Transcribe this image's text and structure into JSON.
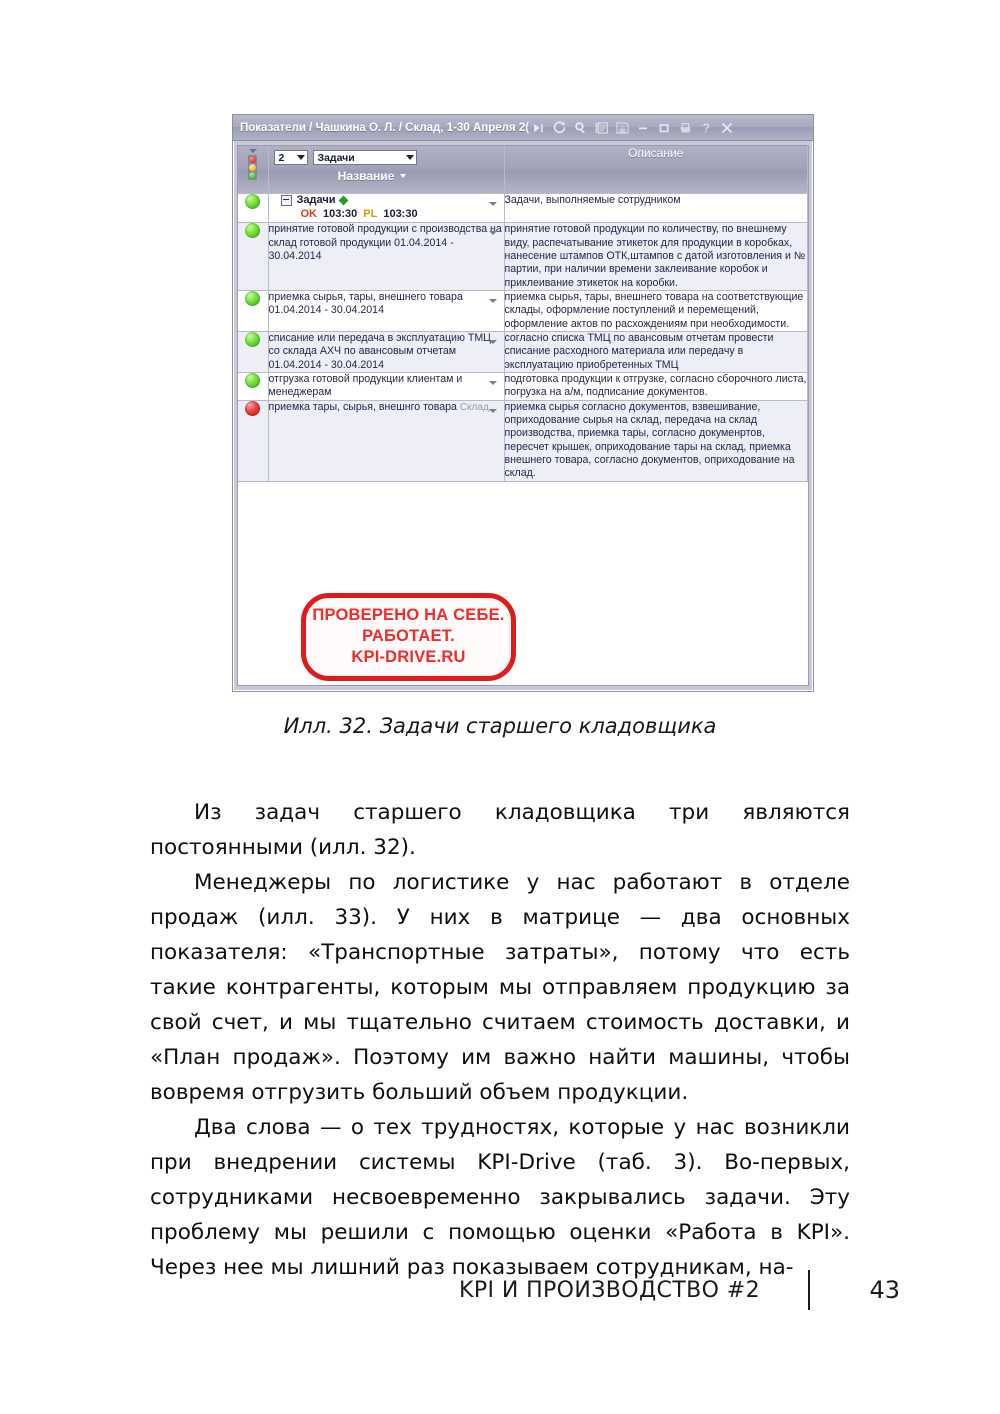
{
  "window": {
    "title": "Показатели / Чашкина О. Л. / Склад, 1-30 Апреля 2(",
    "title_icons": [
      "play-next-icon",
      "refresh-icon",
      "search-icon",
      "report-icon",
      "save-icon",
      "minimize-icon",
      "maximize-icon",
      "print-icon",
      "help-icon",
      "close-icon"
    ]
  },
  "grid": {
    "header": {
      "count_combo": "2",
      "type_combo": "Задачи",
      "sort_label": "Название",
      "description_col": "Описание"
    },
    "group_row": {
      "status": "green",
      "title": "Задачи",
      "ok_label": "OK",
      "ok_value": "103:30",
      "pl_label": "PL",
      "pl_value": "103:30",
      "description": "Задачи, выполняемые сотрудником"
    },
    "rows": [
      {
        "status": "green",
        "name": "принятие готовой продукции с производства на склад готовой продукции 01.04.2014 - 30.04.2014",
        "description": "принятие готовой продукции по количеству, по внешнему виду, распечатывание этикеток для продукции в коробках, нанесение штампов ОТК,штампов с датой изготовления и № партии, при наличии времени заклеивание коробок и приклеивание этикеток на коробки."
      },
      {
        "status": "green",
        "name": "приемка сырья, тары, внешнего товара 01.04.2014 - 30.04.2014",
        "description": "приемка сырья, тары, внешнего товара на соответствующие склады, оформление поступлений и перемещений, оформление актов по расхождениям при необходимости."
      },
      {
        "status": "green",
        "name": "списание или передача в эксплуатацию ТМЦ со склада АХЧ по авансовым отчетам 01.04.2014 - 30.04.2014",
        "description": "согласно списка ТМЦ по авансовым отчетам провести списание расходного материала или передачу в эксплуатацию приобретенных ТМЦ"
      },
      {
        "status": "green",
        "name": "отгрузка готовой продукции клиентам и менеджерам",
        "description": "подготовка продукции к отгрузке, согласно сборочного листа, погрузка на а/м, подписание документов."
      },
      {
        "status": "red",
        "name": "приемка тары, сырья, внешнго товара",
        "name_tag": "Склад,",
        "description": "приемка сырья согласно документов, взвешивание, оприходование сырья на склад, передача на склад производства, приемка тары, согласно докуменртов, пересчет крышек, оприходование тары на склад, приемка внешнего товара, согласно документов, оприходование на склад."
      }
    ]
  },
  "stamp": {
    "line1": "ПРОВЕРЕНО НА СЕБЕ.",
    "line2": "РАБОТАЕТ.",
    "line3": "KPI-DRIVE.RU",
    "color": "#ef2b2b"
  },
  "caption": "Илл. 32. Задачи старшего кладовщика",
  "paragraphs": [
    "Из задач старшего кладовщика три являются постоянными (илл. 32).",
    "Менеджеры по логистике у нас работают в отделе продаж (илл. 33). У них в матрице — два основных показателя: «Транспортные затраты», потому что есть такие контрагенты, которым мы отправляем продукцию за свой счет, и мы тщательно считаем стоимость доставки, и «План продаж». Поэтому им важно найти машины, чтобы вовремя отгрузить больший объем продукции.",
    "Два слова — о тех трудностях, которые у нас возникли при внедрении системы KPI-Drive (таб. 3). Во-первых, сотрудниками несвоевременно закрывались задачи. Эту проблему мы решили с помощью оценки «Работа в KPI». Через нее мы лишний раз показываем сотрудникам, на-"
  ],
  "footer": {
    "title": "KPI И ПРОИЗВОДСТВО #2",
    "page": "43"
  }
}
